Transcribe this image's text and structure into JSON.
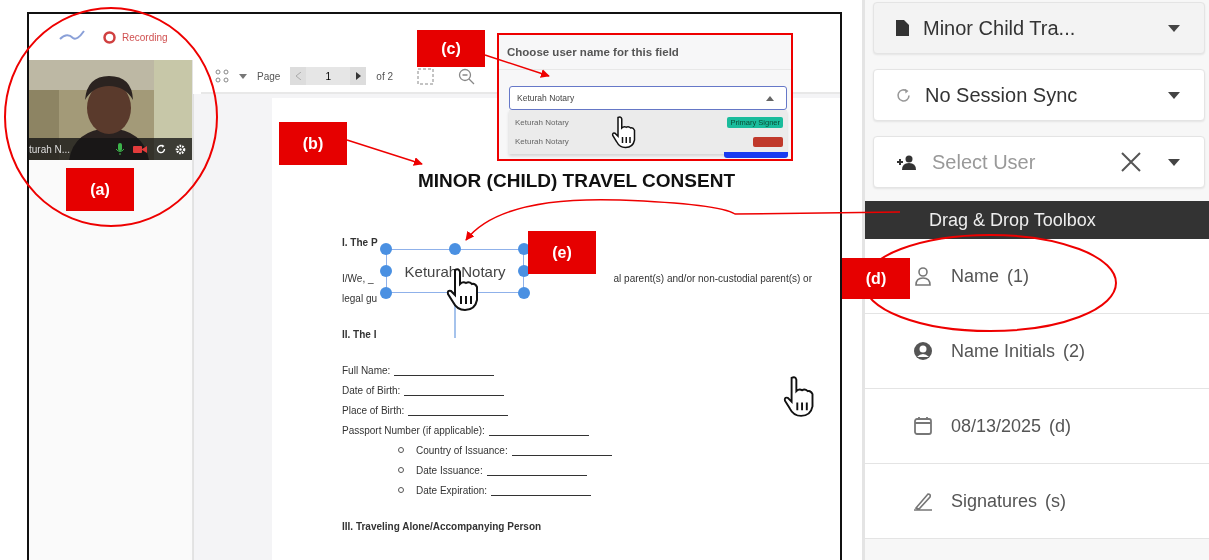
{
  "header": {
    "recording": "Recording"
  },
  "video": {
    "participant": "turah N..."
  },
  "toolbar": {
    "page_label": "Page",
    "page_number": "1",
    "page_count": "of 2"
  },
  "document": {
    "title": "MINOR (CHILD) TRAVEL CONSENT",
    "lines": [
      {
        "kind": "heading",
        "text": "I. The P"
      },
      {
        "kind": "split",
        "left": "I/We, _",
        "right": "al parent(s) and/or non-custodial parent(s) or"
      },
      {
        "kind": "text",
        "text": "legal gu"
      },
      {
        "kind": "heading",
        "text": "II. The I"
      },
      {
        "kind": "blank",
        "text": "Full Name:"
      },
      {
        "kind": "blank",
        "text": "Date of Birth:"
      },
      {
        "kind": "blank",
        "text": "Place of Birth:"
      },
      {
        "kind": "blank",
        "text": "Passport Number (if applicable):"
      },
      {
        "kind": "bullet",
        "text": "Country of Issuance:"
      },
      {
        "kind": "bullet",
        "text": "Date Issuance:"
      },
      {
        "kind": "bullet",
        "text": "Date Expiration:"
      },
      {
        "kind": "heading",
        "text": "III. Traveling Alone/Accompanying Person"
      }
    ]
  },
  "placed_field": {
    "text": "Keturah Notary"
  },
  "user_dialog": {
    "title": "Choose user name for this field",
    "value": "Keturah Notary",
    "options": [
      {
        "name": "Keturah Notary",
        "badge": "Primary Signer",
        "color": "#1abc9c"
      },
      {
        "name": "Keturah Notary",
        "color": "#c0392b"
      }
    ]
  },
  "sidebar": {
    "selects": [
      {
        "kind": "document",
        "value": "Minor Child Tra..."
      },
      {
        "kind": "sync",
        "value": "No Session Sync"
      },
      {
        "kind": "user",
        "placeholder": "Select User"
      }
    ],
    "toolbox_title": "Drag & Drop Toolbox",
    "tools": [
      {
        "kind": "person",
        "label": "Name",
        "shortcut": "(1)"
      },
      {
        "kind": "initials",
        "label": "Name Initials",
        "shortcut": "(2)"
      },
      {
        "kind": "date",
        "label": "08/13/2025",
        "shortcut": "(d)"
      },
      {
        "kind": "signature",
        "label": "Signatures",
        "shortcut": "(s)"
      }
    ]
  },
  "callouts": [
    {
      "text": "(a)"
    },
    {
      "text": "(b)"
    },
    {
      "text": "(c)"
    },
    {
      "text": "(d)"
    },
    {
      "text": "(e)"
    }
  ]
}
